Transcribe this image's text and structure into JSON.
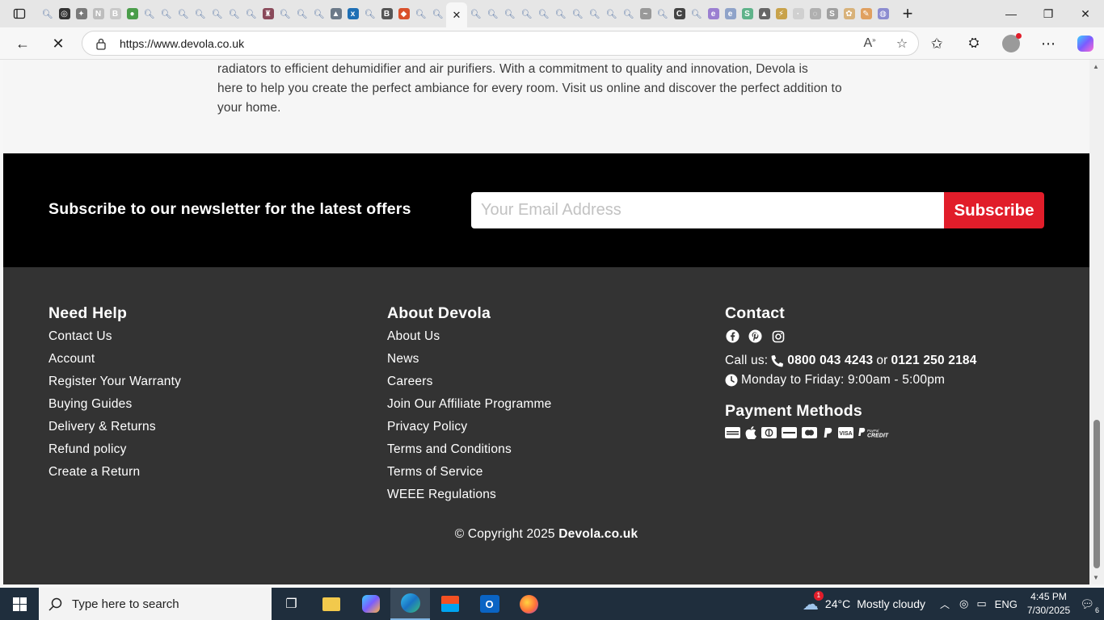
{
  "browser": {
    "url": "https://www.devola.co.uk",
    "accent": "#e11d2a"
  },
  "page": {
    "intro_lines": [
      "radiators to efficient dehumidifier and air purifiers. With a commitment to quality and innovation, Devola is",
      "here to help you create the perfect ambiance for every room. Visit us online and discover the perfect addition to",
      "your home."
    ],
    "newsletter": {
      "title": "Subscribe to our newsletter for the latest offers",
      "email_placeholder": "Your Email Address",
      "button_label": "Subscribe"
    },
    "footer": {
      "need_help": {
        "heading": "Need Help",
        "links": [
          "Contact Us",
          "Account",
          "Register Your Warranty",
          "Buying Guides",
          "Delivery & Returns",
          "Refund policy",
          "Create a Return"
        ]
      },
      "about": {
        "heading": "About Devola",
        "links": [
          "About Us",
          "News",
          "Careers",
          "Join Our Affiliate Programme",
          "Privacy Policy",
          "Terms and Conditions",
          "Terms of Service",
          "WEEE Regulations"
        ]
      },
      "contact": {
        "heading": "Contact",
        "call_prefix": "Call us:",
        "phone_1": "0800 043 4243",
        "or_text": "or",
        "phone_2": "0121 250 2184",
        "hours": "Monday to Friday: 9:00am - 5:00pm",
        "payment_heading": "Payment Methods"
      },
      "copyright_prefix": "© Copyright 2025",
      "copyright_brand": "Devola.co.uk"
    }
  },
  "taskbar": {
    "search_placeholder": "Type here to search",
    "weather_temp": "24°C",
    "weather_desc": "Mostly cloudy",
    "language": "ENG",
    "time": "4:45 PM",
    "date": "7/30/2025",
    "notification_count": "6",
    "weather_badge": "1"
  }
}
